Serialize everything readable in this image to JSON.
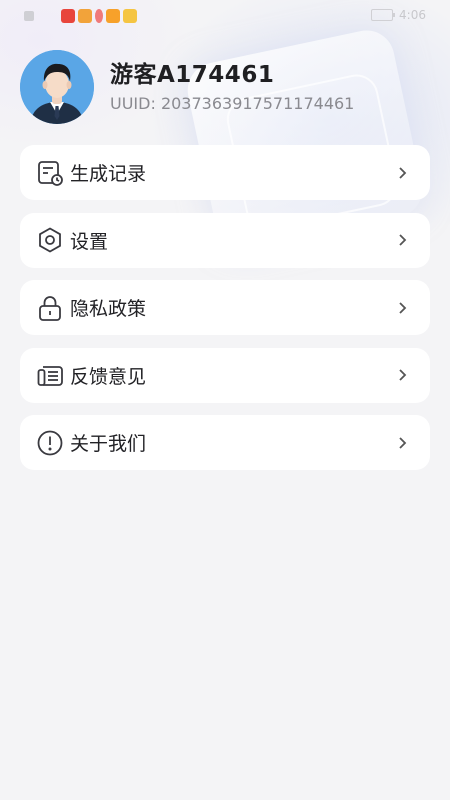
{
  "status_bar": {
    "time": "4:06"
  },
  "profile": {
    "username": "游客A174461",
    "uuid": "UUID: 2037363917571174461"
  },
  "menu": {
    "items": [
      {
        "label": "生成记录",
        "icon": "history-icon"
      },
      {
        "label": "设置",
        "icon": "settings-hexagon-icon"
      },
      {
        "label": "隐私政策",
        "icon": "lock-icon"
      },
      {
        "label": "反馈意见",
        "icon": "feedback-icon"
      },
      {
        "label": "关于我们",
        "icon": "info-exclamation-icon"
      }
    ]
  },
  "colors": {
    "background": "#f4f4f6",
    "card": "#ffffff",
    "text_primary": "#222226",
    "text_secondary": "#8a8a90",
    "avatar_bg": "#5aa6e6"
  }
}
